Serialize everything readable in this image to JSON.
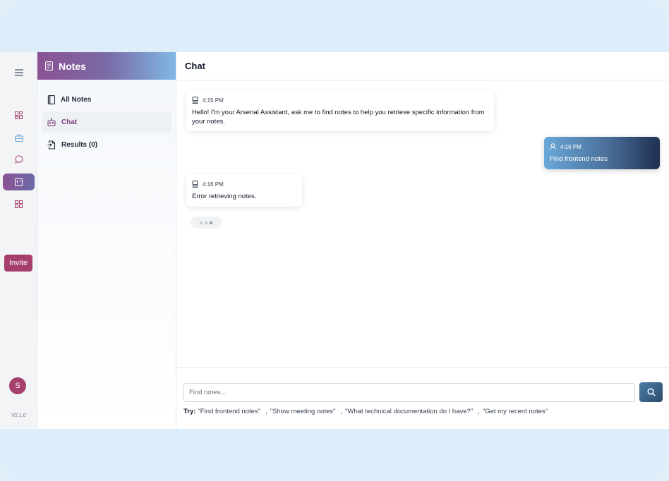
{
  "sidebar": {
    "invite_label": "Invite",
    "avatar_initial": "S",
    "version": "V2.1.0",
    "icons": [
      "hamburger-icon",
      "dashboard-icon",
      "briefcase-icon",
      "chat-bubble-icon",
      "board-icon",
      "grid-icon"
    ]
  },
  "notes_panel": {
    "title": "Notes",
    "items": [
      {
        "label": "All Notes",
        "icon": "notebook-icon"
      },
      {
        "label": "Chat",
        "icon": "robot-icon"
      },
      {
        "label": "Results (0)",
        "icon": "export-file-icon"
      }
    ],
    "active_item": "Chat"
  },
  "chat": {
    "title": "Chat",
    "messages": [
      {
        "from": "assistant",
        "time": "4:15 PM",
        "text": "Hello! I'm your Arsenal Assistant, ask me to find notes to help you retrieve specific information from your notes."
      },
      {
        "from": "user",
        "time": "4:16 PM",
        "text": "Find frontend notes"
      },
      {
        "from": "assistant",
        "time": "4:16 PM",
        "text": "Error retrieving notes."
      }
    ],
    "input_placeholder": "Find notes...",
    "try_label": "Try:",
    "suggestions": [
      "\"Find frontend notes\"",
      "\"Show meeting notes\"",
      "\"What technical documentation do I have?\"",
      "\"Get my recent notes\""
    ],
    "separator": ","
  },
  "colors": {
    "accent": "#8a5293",
    "invite": "#a63f6b",
    "user_bubble_start": "#6aa8d8",
    "user_bubble_end": "#1f2f50",
    "background": "#ddeefa"
  }
}
